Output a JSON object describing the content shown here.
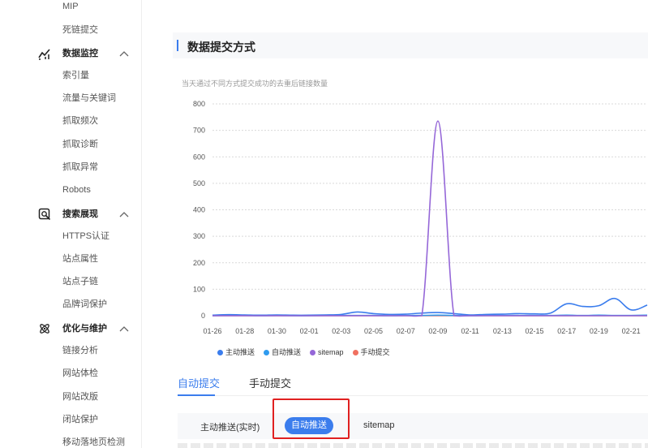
{
  "sidebar": {
    "items_top": [
      "MIP",
      "死链提交"
    ],
    "groups": [
      {
        "title": "数据监控",
        "icon": "line-chart-icon",
        "items": [
          "索引量",
          "流量与关键词",
          "抓取频次",
          "抓取诊断",
          "抓取异常",
          "Robots"
        ]
      },
      {
        "title": "搜索展现",
        "icon": "search-display-icon",
        "items": [
          "HTTPS认证",
          "站点属性",
          "站点子链",
          "品牌词保护"
        ]
      },
      {
        "title": "优化与维护",
        "icon": "atom-icon",
        "items": [
          "链接分析",
          "网站体检",
          "网站改版",
          "闭站保护",
          "移动落地页检测"
        ]
      }
    ]
  },
  "main": {
    "section_title": "数据提交方式",
    "chart_subtitle": "当天通过不同方式提交成功的去重后链接数量",
    "tabs": [
      "自动提交",
      "手动提交"
    ],
    "active_tab": "自动提交",
    "subtabs": [
      "主动推送(实时)",
      "自动推送",
      "sitemap"
    ],
    "active_subtab": "自动推送"
  },
  "colors": {
    "accent": "#3b7ded",
    "highlight": "#e02020",
    "series_active_push": "#3b7ded",
    "series_auto_push": "#2f9bef",
    "series_sitemap": "#9567d8",
    "series_manual": "#f07060"
  },
  "chart_data": {
    "type": "line",
    "title": "",
    "subtitle": "当天通过不同方式提交成功的去重后链接数量",
    "xlabel": "",
    "ylabel": "",
    "ylim": [
      0,
      800
    ],
    "yticks": [
      0,
      100,
      200,
      300,
      400,
      500,
      600,
      700,
      800
    ],
    "grid": true,
    "legend_position": "bottom-left",
    "x": [
      "01-26",
      "01-27",
      "01-28",
      "01-29",
      "01-30",
      "01-31",
      "02-01",
      "02-02",
      "02-03",
      "02-04",
      "02-05",
      "02-06",
      "02-07",
      "02-08",
      "02-09",
      "02-10",
      "02-11",
      "02-12",
      "02-13",
      "02-14",
      "02-15",
      "02-16",
      "02-17",
      "02-18",
      "02-19",
      "02-20",
      "02-21",
      "02-22"
    ],
    "xticks": [
      "01-26",
      "01-28",
      "01-30",
      "02-01",
      "02-03",
      "02-05",
      "02-07",
      "02-09",
      "02-11",
      "02-13",
      "02-15",
      "02-17",
      "02-19",
      "02-21"
    ],
    "series": [
      {
        "name": "主动推送",
        "color": "#3b7ded",
        "values": [
          2,
          4,
          3,
          2,
          3,
          2,
          2,
          3,
          5,
          14,
          8,
          5,
          6,
          10,
          12,
          8,
          3,
          5,
          6,
          8,
          7,
          10,
          45,
          35,
          38,
          65,
          22,
          40
        ]
      },
      {
        "name": "自动推送",
        "color": "#2f9bef",
        "values": [
          0,
          1,
          1,
          0,
          1,
          0,
          0,
          1,
          1,
          1,
          1,
          0,
          1,
          1,
          2,
          1,
          0,
          1,
          1,
          1,
          1,
          1,
          2,
          1,
          2,
          1,
          1,
          2
        ]
      },
      {
        "name": "sitemap",
        "color": "#9567d8",
        "values": [
          0,
          0,
          0,
          0,
          0,
          0,
          0,
          0,
          0,
          0,
          0,
          0,
          0,
          0,
          735,
          0,
          0,
          0,
          0,
          0,
          0,
          0,
          0,
          0,
          0,
          0,
          0,
          0
        ]
      },
      {
        "name": "手动提交",
        "color": "#f07060",
        "values": [
          0,
          0,
          0,
          0,
          0,
          0,
          0,
          0,
          0,
          0,
          0,
          0,
          0,
          0,
          0,
          0,
          0,
          0,
          0,
          0,
          0,
          0,
          0,
          0,
          0,
          0,
          0,
          0
        ]
      }
    ]
  }
}
